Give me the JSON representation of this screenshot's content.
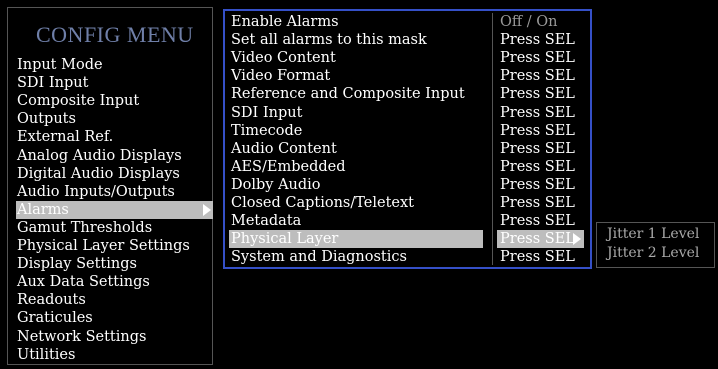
{
  "title": "CONFIG MENU",
  "left_menu": [
    "Input Mode",
    "SDI Input",
    "Composite Input",
    "Outputs",
    "External Ref.",
    "Analog Audio Displays",
    "Digital Audio Displays",
    "Audio Inputs/Outputs",
    "Alarms",
    "Gamut Thresholds",
    "Physical Layer Settings",
    "Display Settings",
    "Aux Data Settings",
    "Readouts",
    "Graticules",
    "Network Settings",
    "Utilities"
  ],
  "left_selected": "Alarms",
  "alarms_menu": [
    {
      "label": "Enable Alarms",
      "value": "Off / On"
    },
    {
      "label": "Set all alarms to this mask",
      "value": "Press SEL"
    },
    {
      "label": "Video Content",
      "value": "Press SEL"
    },
    {
      "label": "Video Format",
      "value": "Press SEL"
    },
    {
      "label": "Reference and Composite Input",
      "value": "Press SEL"
    },
    {
      "label": "SDI Input",
      "value": "Press SEL"
    },
    {
      "label": "Timecode",
      "value": "Press SEL"
    },
    {
      "label": "Audio Content",
      "value": "Press SEL"
    },
    {
      "label": "AES/Embedded",
      "value": "Press SEL"
    },
    {
      "label": "Dolby Audio",
      "value": "Press SEL"
    },
    {
      "label": "Closed Captions/Teletext",
      "value": "Press SEL"
    },
    {
      "label": "Metadata",
      "value": "Press SEL"
    },
    {
      "label": "Physical Layer",
      "value": "Press SEL"
    },
    {
      "label": "System and Diagnostics",
      "value": "Press SEL"
    }
  ],
  "alarms_selected": "Physical Layer",
  "submenu": [
    "Jitter 1 Level",
    "Jitter 2 Level"
  ],
  "colors": {
    "title": "#6f7fa8",
    "highlight": "#bdbdbd",
    "focus_border": "#3550c8"
  }
}
